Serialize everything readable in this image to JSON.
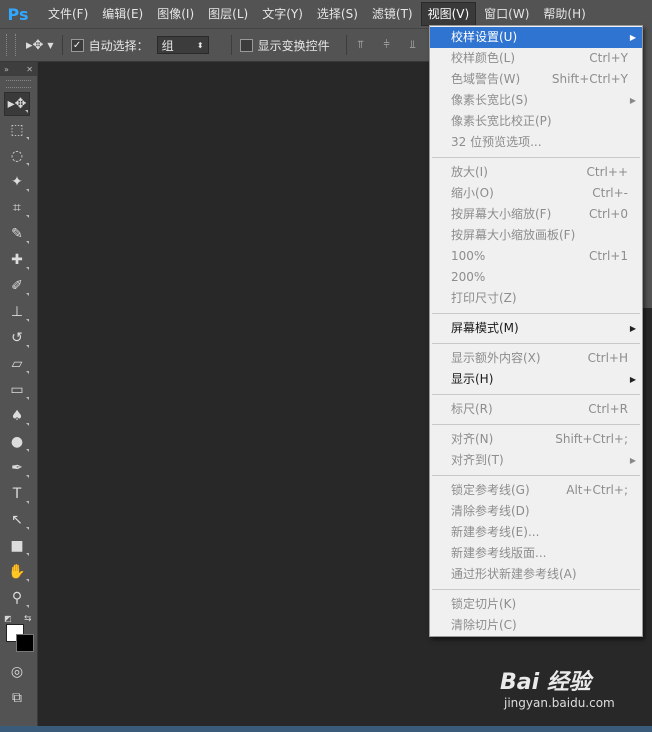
{
  "app": {
    "logo": "Ps"
  },
  "menubar": {
    "items": [
      {
        "label": "文件(F)"
      },
      {
        "label": "编辑(E)"
      },
      {
        "label": "图像(I)"
      },
      {
        "label": "图层(L)"
      },
      {
        "label": "文字(Y)"
      },
      {
        "label": "选择(S)"
      },
      {
        "label": "滤镜(T)"
      },
      {
        "label": "视图(V)"
      },
      {
        "label": "窗口(W)"
      },
      {
        "label": "帮助(H)"
      }
    ],
    "active_index": 7
  },
  "options": {
    "auto_select_label": "自动选择：",
    "auto_select_checked": true,
    "auto_select_value": "组",
    "show_transform_label": "显示变换控件",
    "show_transform_checked": false
  },
  "tools": [
    {
      "icon": "move-tool-icon",
      "glyph": "▸✥",
      "selected": true
    },
    {
      "icon": "marquee-tool-icon",
      "glyph": "⬚"
    },
    {
      "icon": "lasso-tool-icon",
      "glyph": "◌"
    },
    {
      "icon": "magic-wand-tool-icon",
      "glyph": "✦"
    },
    {
      "icon": "crop-tool-icon",
      "glyph": "⌗"
    },
    {
      "icon": "eyedropper-tool-icon",
      "glyph": "✎"
    },
    {
      "icon": "healing-brush-tool-icon",
      "glyph": "✚"
    },
    {
      "icon": "brush-tool-icon",
      "glyph": "✐"
    },
    {
      "icon": "clone-stamp-tool-icon",
      "glyph": "⊥"
    },
    {
      "icon": "history-brush-tool-icon",
      "glyph": "↺"
    },
    {
      "icon": "eraser-tool-icon",
      "glyph": "▱"
    },
    {
      "icon": "gradient-tool-icon",
      "glyph": "▭"
    },
    {
      "icon": "blur-tool-icon",
      "glyph": "♠"
    },
    {
      "icon": "dodge-tool-icon",
      "glyph": "●"
    },
    {
      "icon": "pen-tool-icon",
      "glyph": "✒"
    },
    {
      "icon": "type-tool-icon",
      "glyph": "T"
    },
    {
      "icon": "path-selection-tool-icon",
      "glyph": "↖"
    },
    {
      "icon": "rectangle-tool-icon",
      "glyph": "■"
    },
    {
      "icon": "hand-tool-icon",
      "glyph": "✋"
    },
    {
      "icon": "zoom-tool-icon",
      "glyph": "⚲"
    }
  ],
  "view_menu": {
    "items": [
      {
        "label": "校样设置(U)",
        "shortcut": "",
        "submenu": true,
        "enabled": true,
        "highlighted": true
      },
      {
        "label": "校样颜色(L)",
        "shortcut": "Ctrl+Y",
        "enabled": false
      },
      {
        "label": "色域警告(W)",
        "shortcut": "Shift+Ctrl+Y",
        "enabled": false
      },
      {
        "label": "像素长宽比(S)",
        "shortcut": "",
        "submenu": true,
        "enabled": false
      },
      {
        "label": "像素长宽比校正(P)",
        "shortcut": "",
        "enabled": false
      },
      {
        "label": "32 位预览选项...",
        "shortcut": "",
        "enabled": false
      },
      {
        "separator": true
      },
      {
        "label": "放大(I)",
        "shortcut": "Ctrl++",
        "enabled": false
      },
      {
        "label": "缩小(O)",
        "shortcut": "Ctrl+-",
        "enabled": false
      },
      {
        "label": "按屏幕大小缩放(F)",
        "shortcut": "Ctrl+0",
        "enabled": false
      },
      {
        "label": "按屏幕大小缩放画板(F)",
        "shortcut": "",
        "enabled": false
      },
      {
        "label": "100%",
        "shortcut": "Ctrl+1",
        "enabled": false
      },
      {
        "label": "200%",
        "shortcut": "",
        "enabled": false
      },
      {
        "label": "打印尺寸(Z)",
        "shortcut": "",
        "enabled": false
      },
      {
        "separator": true
      },
      {
        "label": "屏幕模式(M)",
        "shortcut": "",
        "submenu": true,
        "enabled": true
      },
      {
        "separator": true
      },
      {
        "label": "显示额外内容(X)",
        "shortcut": "Ctrl+H",
        "enabled": false
      },
      {
        "label": "显示(H)",
        "shortcut": "",
        "submenu": true,
        "enabled": true
      },
      {
        "separator": true
      },
      {
        "label": "标尺(R)",
        "shortcut": "Ctrl+R",
        "enabled": false
      },
      {
        "separator": true
      },
      {
        "label": "对齐(N)",
        "shortcut": "Shift+Ctrl+;",
        "enabled": false
      },
      {
        "label": "对齐到(T)",
        "shortcut": "",
        "submenu": true,
        "enabled": false
      },
      {
        "separator": true
      },
      {
        "label": "锁定参考线(G)",
        "shortcut": "Alt+Ctrl+;",
        "enabled": false
      },
      {
        "label": "清除参考线(D)",
        "shortcut": "",
        "enabled": false
      },
      {
        "label": "新建参考线(E)...",
        "shortcut": "",
        "enabled": false
      },
      {
        "label": "新建参考线版面...",
        "shortcut": "",
        "enabled": false
      },
      {
        "label": "通过形状新建参考线(A)",
        "shortcut": "",
        "enabled": false
      },
      {
        "separator": true
      },
      {
        "label": "锁定切片(K)",
        "shortcut": "",
        "enabled": false
      },
      {
        "label": "清除切片(C)",
        "shortcut": "",
        "enabled": false
      }
    ]
  },
  "watermark": {
    "logo": "Bai 经验",
    "url": "jingyan.baidu.com"
  }
}
